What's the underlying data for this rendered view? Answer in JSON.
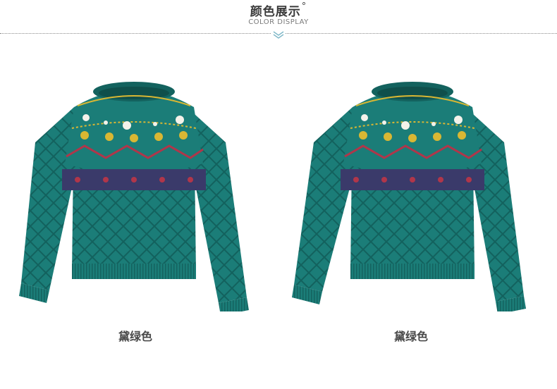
{
  "header": {
    "title": "颜色展示",
    "title_suffix": "°",
    "subtitle": "COLOR DISPLAY",
    "divider_color": "#8a8a8a",
    "chevron_color": "#7fb8c8"
  },
  "products": [
    {
      "color_label": "黛绿色",
      "image": "teal-fair-isle-sweater-front",
      "swatch": "#1b7d78"
    },
    {
      "color_label": "黛绿色",
      "image": "teal-fair-isle-sweater-front",
      "swatch": "#1b7d78"
    }
  ],
  "palette": {
    "body": "#1b7d78",
    "shadow": "#13625e",
    "navy": "#3a3a6a",
    "red": "#b0364a",
    "yellow": "#d9b733",
    "white": "#f4f2ea"
  }
}
